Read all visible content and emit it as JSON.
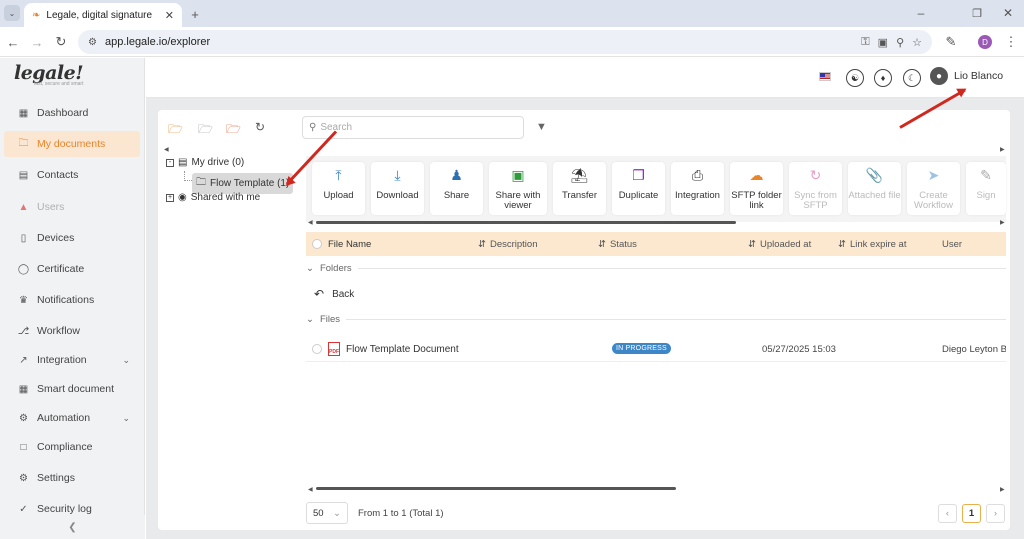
{
  "browser": {
    "tab_title": "Legale, digital signature",
    "url": "app.legale.io/explorer",
    "profile_initial": "D"
  },
  "sidebar": {
    "logo_text": "legale!",
    "logo_tagline": "fast, secure and smart",
    "items": [
      {
        "label": "Dashboard",
        "icon": "dashboard-icon"
      },
      {
        "label": "My documents",
        "icon": "folder-icon"
      },
      {
        "label": "Contacts",
        "icon": "contacts-icon"
      },
      {
        "label": "Users",
        "icon": "lock-icon"
      },
      {
        "label": "Devices",
        "icon": "device-icon"
      },
      {
        "label": "Certificate",
        "icon": "shield-icon"
      },
      {
        "label": "Notifications",
        "icon": "bell-icon"
      },
      {
        "label": "Workflow",
        "icon": "workflow-icon"
      },
      {
        "label": "Integration",
        "icon": "integration-icon"
      },
      {
        "label": "Smart document",
        "icon": "smart-document-icon"
      },
      {
        "label": "Automation",
        "icon": "gear-icon"
      },
      {
        "label": "Compliance",
        "icon": "chat-icon"
      },
      {
        "label": "Settings",
        "icon": "settings-icon"
      },
      {
        "label": "Security log",
        "icon": "shield-check-icon"
      }
    ],
    "active_item": "My documents",
    "disabled_item": "Users"
  },
  "topbar": {
    "user_name": "Lio Blanco"
  },
  "explorer": {
    "search_placeholder": "Search",
    "tree": {
      "my_drive": "My drive (0)",
      "selected_folder": "Flow Template (1)",
      "shared": "Shared with me"
    },
    "actions": [
      {
        "label": "Upload",
        "icon": "upload-icon",
        "enabled": true
      },
      {
        "label": "Download",
        "icon": "download-icon",
        "enabled": true
      },
      {
        "label": "Share",
        "icon": "share-icon",
        "enabled": true
      },
      {
        "label": "Share with viewer",
        "icon": "share-viewer-icon",
        "enabled": true
      },
      {
        "label": "Transfer",
        "icon": "transfer-icon",
        "enabled": true
      },
      {
        "label": "Duplicate",
        "icon": "duplicate-icon",
        "enabled": true
      },
      {
        "label": "Integration",
        "icon": "integration-icon",
        "enabled": true
      },
      {
        "label": "SFTP folder link",
        "icon": "sftp-icon",
        "enabled": true
      },
      {
        "label": "Sync from SFTP",
        "icon": "sync-icon",
        "enabled": false
      },
      {
        "label": "Attached file",
        "icon": "paperclip-icon",
        "enabled": false
      },
      {
        "label": "Create Workflow",
        "icon": "send-icon",
        "enabled": false
      },
      {
        "label": "Sign",
        "icon": "sign-icon",
        "enabled": false
      }
    ],
    "columns": [
      "File Name",
      "Description",
      "Status",
      "Uploaded at",
      "Link expire at",
      "User"
    ],
    "group_folders": "Folders",
    "back_label": "Back",
    "group_files": "Files",
    "files": [
      {
        "name": "Flow Template Document",
        "description": "",
        "status": "IN PROGRESS",
        "uploaded_at": "05/27/2025 15:03",
        "link_expire": "",
        "user": "Diego Leyton Bla"
      }
    ],
    "page_size": "50",
    "pagination_text": "From 1 to 1 (Total 1)",
    "current_page": "1"
  },
  "colors": {
    "accent": "#e8842a",
    "header_bg": "#fbe8cf",
    "status_badge": "#3d87c9",
    "annotation_arrow": "#d0281f"
  }
}
